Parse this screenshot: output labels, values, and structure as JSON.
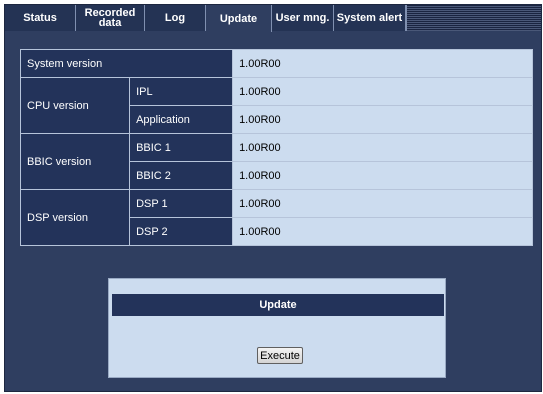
{
  "tabs": [
    {
      "label": "Status",
      "active": false
    },
    {
      "label": "Recorded data",
      "active": false
    },
    {
      "label": "Log",
      "active": false
    },
    {
      "label": "Update",
      "active": true
    },
    {
      "label": "User mng.",
      "active": false
    },
    {
      "label": "System alert",
      "active": false
    }
  ],
  "versions": {
    "system": {
      "label": "System version",
      "value": "1.00R00"
    },
    "cpu": {
      "label": "CPU version",
      "ipl": {
        "label": "IPL",
        "value": "1.00R00"
      },
      "application": {
        "label": "Application",
        "value": "1.00R00"
      }
    },
    "bbic": {
      "label": "BBIC version",
      "bbic1": {
        "label": "BBIC 1",
        "value": "1.00R00"
      },
      "bbic2": {
        "label": "BBIC 2",
        "value": "1.00R00"
      }
    },
    "dsp": {
      "label": "DSP version",
      "dsp1": {
        "label": "DSP 1",
        "value": "1.00R00"
      },
      "dsp2": {
        "label": "DSP 2",
        "value": "1.00R00"
      }
    }
  },
  "update_panel": {
    "title": "Update",
    "execute_label": "Execute"
  }
}
